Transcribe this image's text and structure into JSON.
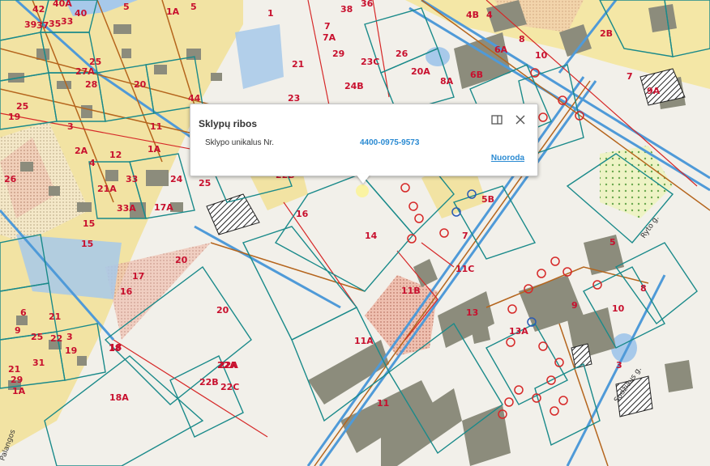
{
  "popup": {
    "title": "Sklypų ribos",
    "field_label": "Sklypo unikalus Nr.",
    "field_value": "4400-0975-9573",
    "link": "Nuoroda",
    "maximize_icon": "maximize-icon",
    "close_icon": "close-icon"
  },
  "map": {
    "colors": {
      "background": "#f2f0ea",
      "parcel_line": "#1a8a8a",
      "road_line": "#4f9ad8",
      "red_line": "#d62828",
      "building": "#8c8c7c",
      "yellow_area": "#f4e7a6",
      "dotted_area": "#eebfae",
      "water": "#a7c9ea"
    },
    "parcel_labels": [
      "40A",
      "40",
      "5",
      "1A",
      "5",
      "4B",
      "4",
      "2B",
      "42",
      "39",
      "37",
      "35",
      "33",
      "38",
      "36",
      "26",
      "20A",
      "8A",
      "6B",
      "6A",
      "8",
      "10",
      "7",
      "9A",
      "27A",
      "28",
      "25",
      "20",
      "23C",
      "24B",
      "23",
      "21",
      "29",
      "13",
      "11",
      "1A",
      "7A",
      "7",
      "1",
      "25",
      "19",
      "3",
      "2A",
      "12",
      "26",
      "4",
      "44",
      "25",
      "21A",
      "24",
      "33",
      "33A",
      "17A",
      "22B",
      "22A",
      "18",
      "16",
      "14",
      "5B",
      "7",
      "11C",
      "11B",
      "13",
      "13A",
      "9",
      "5",
      "10",
      "8",
      "20",
      "15",
      "16",
      "20",
      "21",
      "22",
      "22B",
      "22C",
      "22A",
      "18",
      "18A",
      "11A",
      "11",
      "3",
      "17",
      "6",
      "3",
      "9",
      "15",
      "19",
      "25",
      "21",
      "29",
      "31",
      "1A",
      "3A",
      "4"
    ],
    "street_labels": [
      "Ryto g.",
      "Sodžiaus g.",
      "Palangos"
    ]
  }
}
